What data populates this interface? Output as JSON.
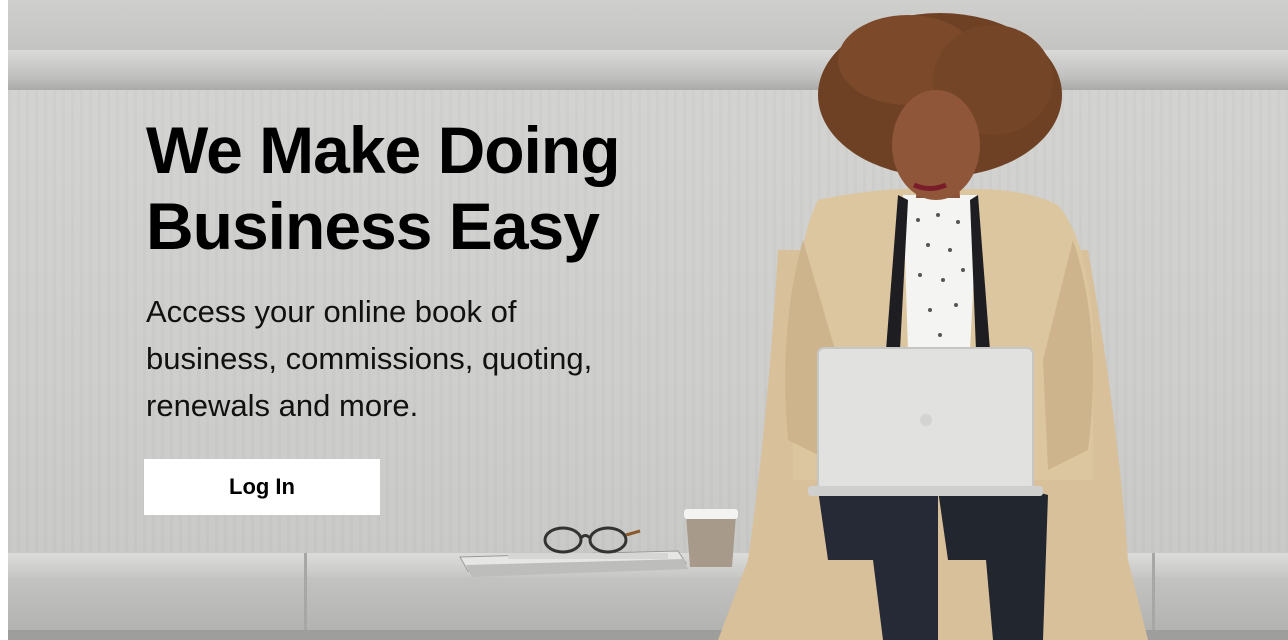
{
  "hero": {
    "headline_line1": "We Make Doing",
    "headline_line2": "Business Easy",
    "subtext_line1": "Access your online book of",
    "subtext_line2": "business, commissions, quoting,",
    "subtext_line3": "renewals and more.",
    "login_label": "Log In"
  },
  "colors": {
    "text": "#000000",
    "button_bg": "#ffffff",
    "wall": "#cfcfcd"
  }
}
